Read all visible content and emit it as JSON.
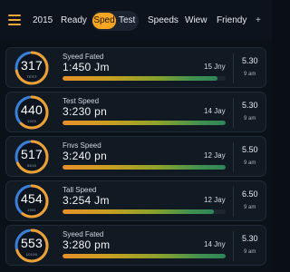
{
  "topbar": {
    "menu_icon": "hamburger-menu-icon",
    "tabs": [
      "2015",
      "Ready",
      "Sped",
      "Test",
      "Speeds",
      "Wiew",
      "Friendy"
    ],
    "active_tab": "Sped",
    "more_glyph": "+"
  },
  "colors": {
    "accent": "#f6a623",
    "ring_orange": "#f0a030",
    "ring_blue": "#3b7fd8",
    "card_bg": "#111923"
  },
  "cards": [
    {
      "value": "317",
      "sub": "TEST",
      "label": "Syeed Fated",
      "time": "1:450 Jm",
      "date": "15 Jny",
      "side_value": "5.30",
      "side_unit": "9 am",
      "progress": 0.95,
      "ring": 0.72
    },
    {
      "value": "440",
      "sub": "1925",
      "label": "Test Speed",
      "time": "3:230 pn",
      "date": "14 Jay",
      "side_value": "5.30",
      "side_unit": "9 am",
      "progress": 1.0,
      "ring": 0.62
    },
    {
      "value": "517",
      "sub": "5615",
      "label": "Fnvs Speed",
      "time": "3:240 pn",
      "date": "12 Jay",
      "side_value": "5.50",
      "side_unit": "9 am",
      "progress": 1.0,
      "ring": 0.68
    },
    {
      "value": "454",
      "sub": "1931",
      "label": "Tall Speed",
      "time": "3:254 Jm",
      "date": "12 Jay",
      "side_value": "6.50",
      "side_unit": "9 am",
      "progress": 0.93,
      "ring": 0.6
    },
    {
      "value": "553",
      "sub": "10190",
      "label": "Syeed Fated",
      "time": "3:280 pm",
      "date": "14 Jny",
      "side_value": "5.30",
      "side_unit": "9 am",
      "progress": 1.0,
      "ring": 0.7
    }
  ]
}
